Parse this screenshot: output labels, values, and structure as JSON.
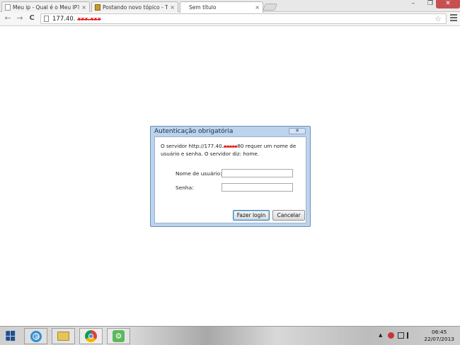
{
  "tabs": [
    {
      "title": "Meu ip - Qual é o Meu IP?",
      "close": "×"
    },
    {
      "title": "Postando novo tópico - T",
      "close": "×"
    },
    {
      "title": "Sem título",
      "close": "×"
    }
  ],
  "window_controls": {
    "minimize": "–",
    "restore": "❐",
    "close": "✕"
  },
  "nav": {
    "back": "←",
    "forward": "→",
    "reload": "C"
  },
  "address": {
    "url": "177.40.",
    "redacted": "xxx.xxx"
  },
  "toolbar_icons": {
    "star": "☆"
  },
  "dialog": {
    "title": "Autenticação obrigatória",
    "close": "✕",
    "message_part1": "O servidor http://177.40.",
    "message_redacted": "xxxxx",
    "message_part2": "80 requer um nome de usuário e senha. O servidor diz: home.",
    "username_label": "Nome de usuário:",
    "username_value": "",
    "password_label": "Senha:",
    "password_value": "",
    "login_button": "Fazer login",
    "cancel_button": "Cancelar"
  },
  "taskbar": {
    "clock_time": "06:45",
    "clock_date": "22/07/2013",
    "tray_arrow": "▲"
  },
  "icons": [
    "page-icon",
    "bookmark-icon",
    "star-icon",
    "menu-icon",
    "windows-start-icon",
    "internet-explorer-icon",
    "file-explorer-icon",
    "chrome-icon",
    "app-gear-icon",
    "flag-icon",
    "network-icon",
    "volume-icon"
  ]
}
